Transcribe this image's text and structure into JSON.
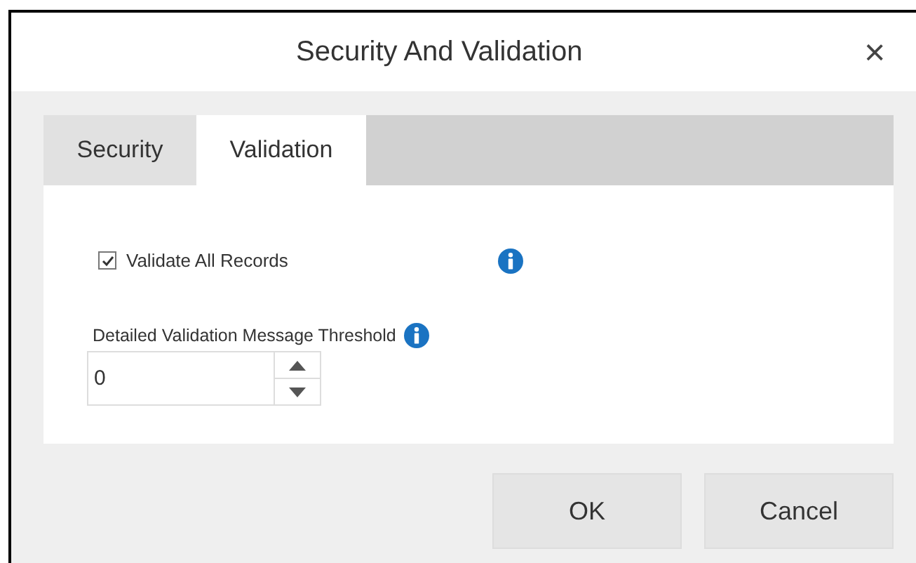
{
  "window": {
    "title": "Security And Validation",
    "close": "×"
  },
  "tabs": [
    {
      "label": "Security",
      "selected": false
    },
    {
      "label": "Validation",
      "selected": true
    }
  ],
  "validate_all_records": {
    "label": "Validate All Records",
    "checked": true
  },
  "threshold": {
    "label": "Detailed Validation Message Threshold",
    "value": "0"
  },
  "buttons": [
    "OK",
    "Cancel"
  ]
}
